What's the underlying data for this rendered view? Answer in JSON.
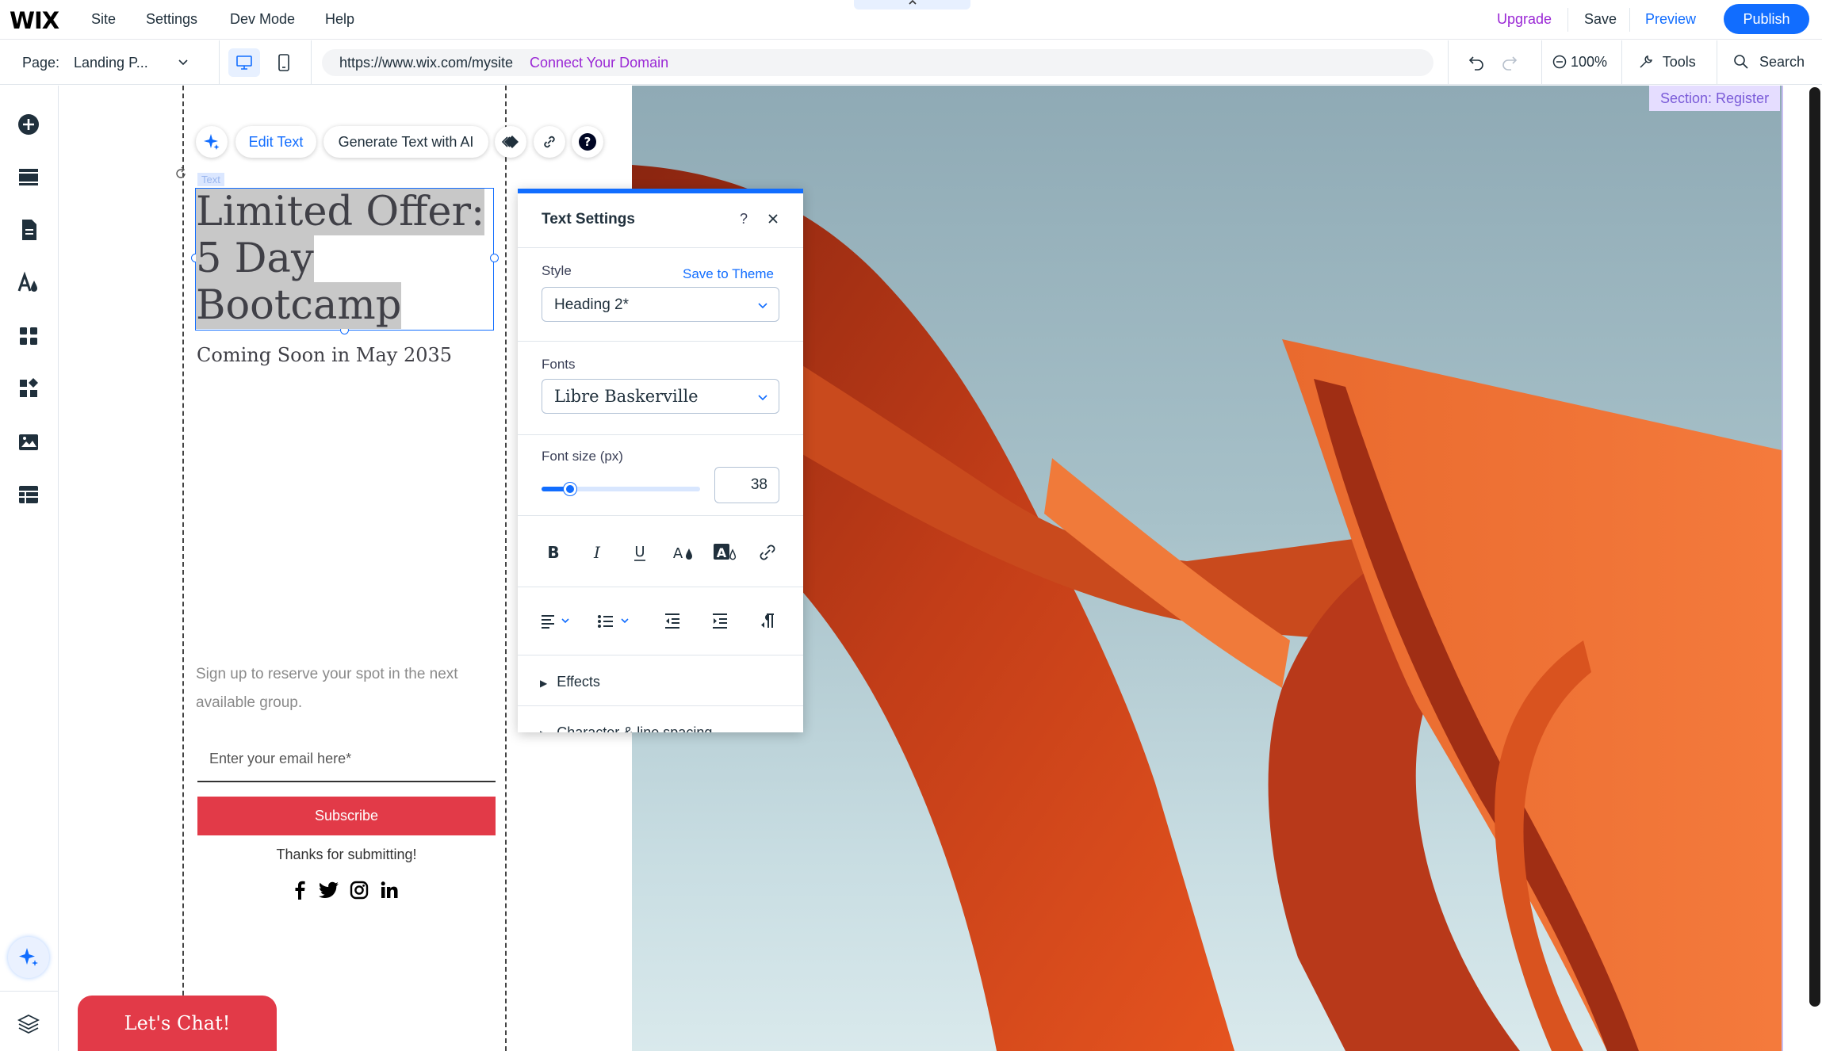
{
  "topbar": {
    "logo": "WIX",
    "menu": [
      "Site",
      "Settings",
      "Dev Mode",
      "Help"
    ],
    "upgrade": "Upgrade",
    "save": "Save",
    "preview": "Preview",
    "publish": "Publish"
  },
  "bar2": {
    "page_label": "Page:",
    "page_name": "Landing P...",
    "url": "https://www.wix.com/mysite",
    "connect_domain": "Connect Your Domain",
    "zoom": "100%",
    "tools": "Tools",
    "search": "Search"
  },
  "text_toolbar": {
    "edit_text": "Edit Text",
    "generate_ai": "Generate Text with AI"
  },
  "canvas": {
    "text_tag": "Text",
    "heading_lines": [
      "Limited Offer:",
      "5 Day",
      "Bootcamp"
    ],
    "subheading": "Coming Soon in May 2035",
    "signup_text": "Sign up to reserve your spot in the next available group.",
    "email_placeholder": "Enter your email here*",
    "subscribe": "Subscribe",
    "thanks": "Thanks for submitting!",
    "chat": "Let's Chat!",
    "section_label": "Section: Register"
  },
  "panel": {
    "title": "Text Settings",
    "help": "?",
    "style_label": "Style",
    "save_to_theme": "Save to Theme",
    "style_value": "Heading 2*",
    "fonts_label": "Fonts",
    "font_value": "Libre Baskerville",
    "font_size_label": "Font size (px)",
    "font_size": "38",
    "font_size_slider_fraction": 0.18,
    "effects": "Effects",
    "char_spacing": "Character & line spacing"
  },
  "colors": {
    "accent": "#116dff",
    "upgrade": "#9a27d5",
    "subscribe": "#e23a48",
    "section_label_bg": "#e5ddff"
  }
}
